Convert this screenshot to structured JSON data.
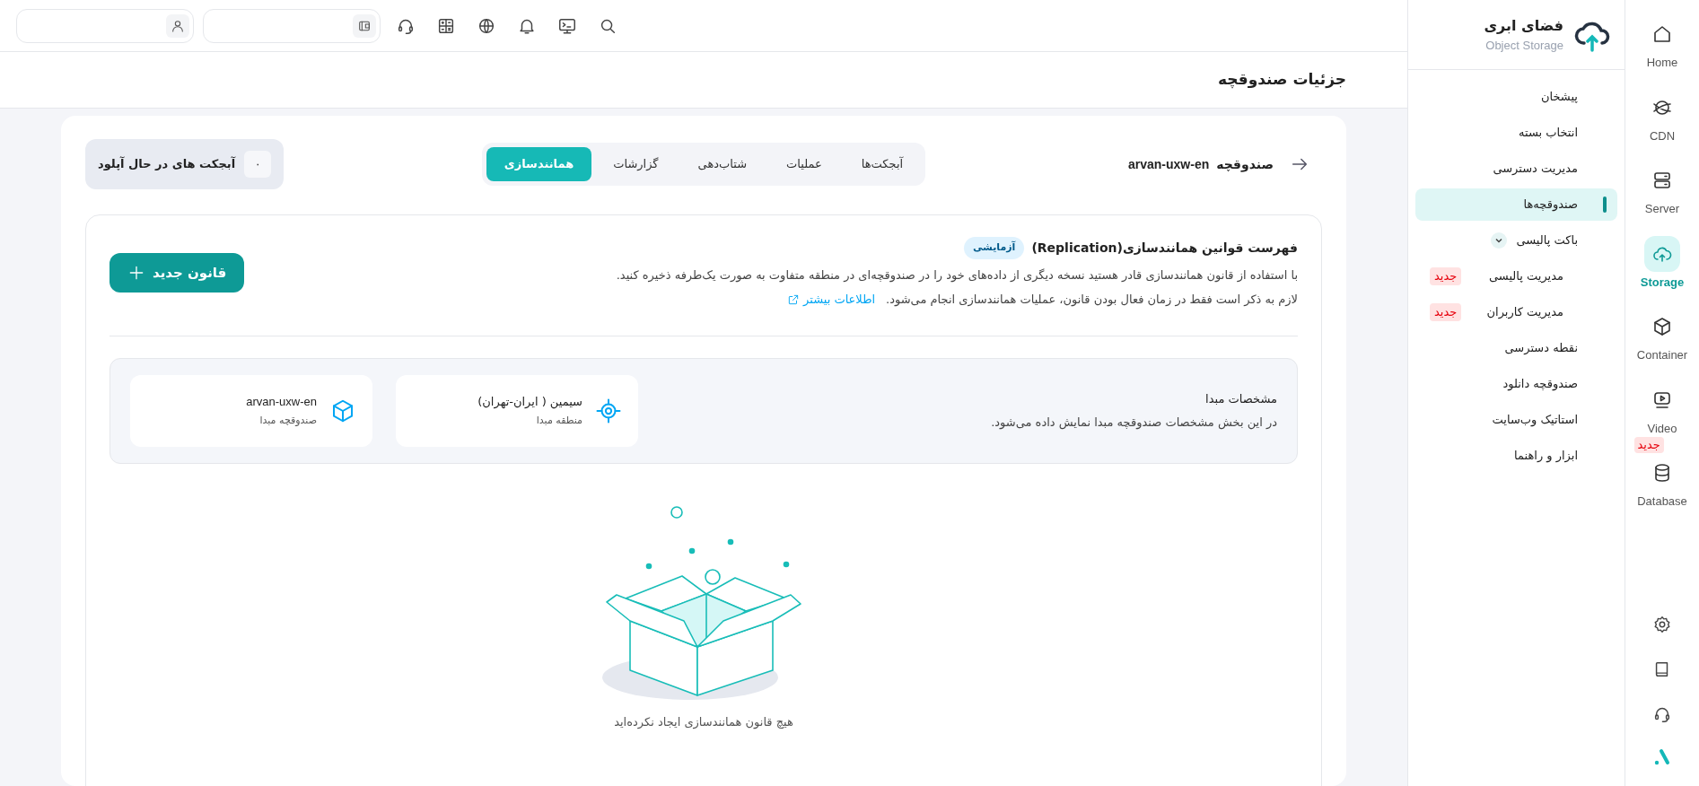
{
  "rail": {
    "items": [
      {
        "label": "Home",
        "selected": false
      },
      {
        "label": "CDN",
        "selected": false
      },
      {
        "label": "Server",
        "selected": false
      },
      {
        "label": "Storage",
        "selected": true
      },
      {
        "label": "Container",
        "selected": false
      },
      {
        "label": "Video",
        "selected": false
      },
      {
        "label": "Database",
        "selected": false,
        "badge": "جدید"
      }
    ]
  },
  "sidebar": {
    "title": "فضای ابری",
    "subtitle": "Object Storage",
    "items": [
      {
        "label": "پیشخان",
        "selected": false
      },
      {
        "label": "انتخاب بسته",
        "selected": false
      },
      {
        "label": "مدیریت دسترسی",
        "selected": false
      },
      {
        "label": "صندوقچه‌ها",
        "selected": true
      },
      {
        "label": "باکت پالیسی",
        "selected": false,
        "expanded": true,
        "children": [
          {
            "label": "مدیریت پالیسی",
            "selected": false,
            "badge": "جدید"
          },
          {
            "label": "مدیریت کاربران",
            "selected": false,
            "badge": "جدید"
          }
        ]
      },
      {
        "label": "نقطه دسترسی",
        "selected": false
      },
      {
        "label": "صندوقچه دانلود",
        "selected": false
      },
      {
        "label": "استاتیک وب‌سایت",
        "selected": false
      },
      {
        "label": "ابزار و راهنما",
        "selected": false
      }
    ]
  },
  "page_title": "جزئیات صندوقچه",
  "bucket": {
    "label": "صندوقچه",
    "name": "arvan-uxw-en"
  },
  "tabs": [
    {
      "label": "آبجکت‌ها",
      "selected": false
    },
    {
      "label": "عملیات",
      "selected": false
    },
    {
      "label": "شتاب‌دهی",
      "selected": false
    },
    {
      "label": "گزارشات",
      "selected": false
    },
    {
      "label": "همانندسازی",
      "selected": true
    }
  ],
  "uploads": {
    "count": "۰",
    "label": "آبجکت های در حال آپلود"
  },
  "replication": {
    "title": "فهرست قوانین همانندسازی(Replication)",
    "badge": "آزمایشی",
    "description": "با استفاده از قانون همانندسازی قادر هستید نسخه دیگری از داده‌های خود را در صندوقچه‌ای در منطقه متفاوت به صورت یک‌طرفه ذخیره کنید.",
    "note": "لازم به ذکر است فقط در زمان فعال بودن قانون، عملیات همانندسازی انجام می‌شود.",
    "link": "اطلاعات بیشتر",
    "button": "قانون جدید"
  },
  "origin": {
    "title": "مشخصات مبدا",
    "description": "در این بخش مشخصات صندوقچه مبدا نمایش داده می‌شود.",
    "cards": [
      {
        "value": "سیمین ( ایران-تهران)",
        "label": "منطقه مبدا"
      },
      {
        "value": "arvan-uxw-en",
        "label": "صندوقچه مبدا"
      }
    ]
  },
  "empty": {
    "message": "هیچ قانون همانندسازی ایجاد نکرده‌اید"
  }
}
